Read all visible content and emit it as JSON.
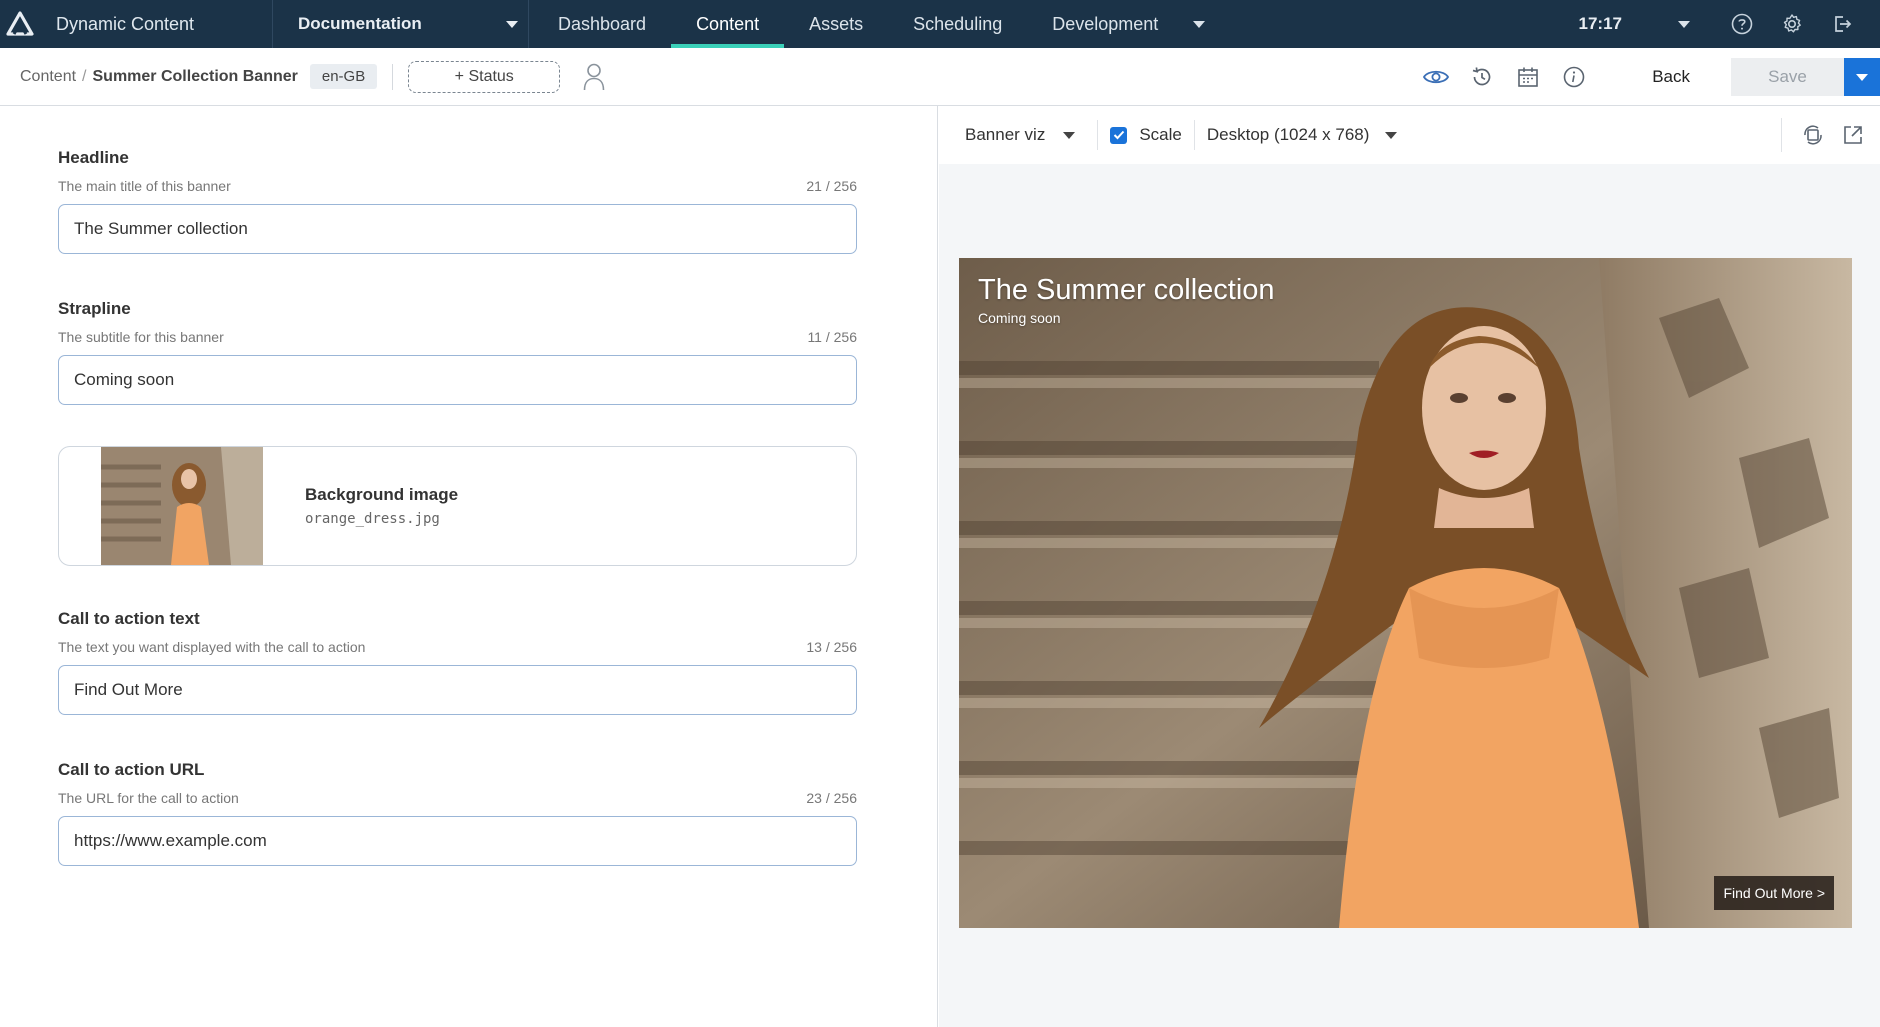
{
  "app": {
    "name": "Dynamic Content"
  },
  "hub": {
    "label": "Documentation"
  },
  "nav": {
    "tabs": [
      "Dashboard",
      "Content",
      "Assets",
      "Scheduling",
      "Development"
    ],
    "active_index": 1
  },
  "clock": "17:17",
  "breadcrumb": {
    "root": "Content",
    "separator": "/",
    "current": "Summer Collection Banner"
  },
  "locale": "en-GB",
  "status_label": "+ Status",
  "actions": {
    "back": "Back",
    "save": "Save"
  },
  "form": {
    "headline": {
      "label": "Headline",
      "description": "The main title of this banner",
      "count": "21 / 256",
      "value": "The Summer collection"
    },
    "strapline": {
      "label": "Strapline",
      "description": "The subtitle for this banner",
      "count": "11 / 256",
      "value": "Coming soon"
    },
    "image": {
      "title": "Background image",
      "filename": "orange_dress.jpg"
    },
    "cta_text": {
      "label": "Call to action text",
      "description": "The text you want displayed with the call to action",
      "count": "13 / 256",
      "value": "Find Out More"
    },
    "cta_url": {
      "label": "Call to action URL",
      "description": "The URL for the call to action",
      "count": "23 / 256",
      "value": "https://www.example.com"
    }
  },
  "preview": {
    "visualization": "Banner viz",
    "scale_label": "Scale",
    "scale_checked": true,
    "device": "Desktop (1024 x 768)",
    "banner": {
      "headline": "The Summer collection",
      "strapline": "Coming soon",
      "cta": "Find Out More >"
    }
  },
  "colors": {
    "topbar": "#1b3348",
    "active_tab_underline": "#3ad0b8",
    "accent": "#1a73d9"
  }
}
